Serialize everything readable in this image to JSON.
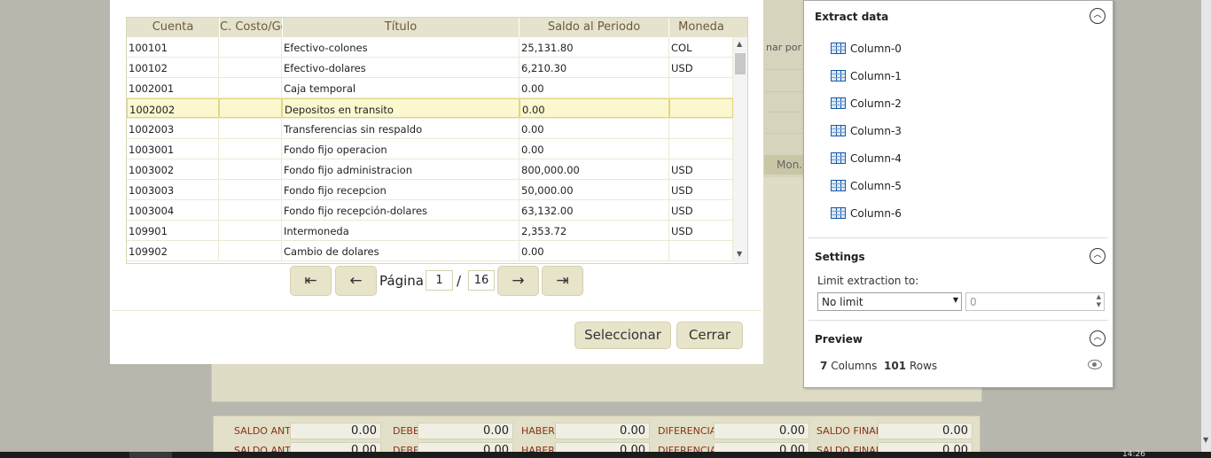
{
  "background": {
    "side_text": "nar por T",
    "mon_label": "Mon.",
    "totals_rows": [
      [
        {
          "label": "SALDO ANT.",
          "value": "0.00"
        },
        {
          "label": "DEBE",
          "value": "0.00"
        },
        {
          "label": "HABER",
          "value": "0.00"
        },
        {
          "label": "DIFERENCIA",
          "value": "0.00"
        },
        {
          "label": "SALDO FINAL",
          "value": "0.00"
        }
      ],
      [
        {
          "label": "SALDO ANT.",
          "value": "0.00"
        },
        {
          "label": "DEBE",
          "value": "0.00"
        },
        {
          "label": "HABER",
          "value": "0.00"
        },
        {
          "label": "DIFERENCIA",
          "value": "0.00"
        },
        {
          "label": "SALDO FINAL",
          "value": "0.00"
        }
      ]
    ],
    "clock": "14:26"
  },
  "dialog": {
    "columns": [
      "Cuenta",
      "C. Costo/Gc",
      "Título",
      "Saldo al Periodo",
      "Moneda"
    ],
    "rows": [
      [
        "100101",
        "",
        "Efectivo-colones",
        "25,131.80",
        "COL"
      ],
      [
        "100102",
        "",
        "Efectivo-dolares",
        "6,210.30",
        "USD"
      ],
      [
        "1002001",
        "",
        "Caja temporal",
        "0.00",
        ""
      ],
      [
        "1002002",
        "",
        "Depositos en transito",
        "0.00",
        ""
      ],
      [
        "1002003",
        "",
        "Transferencias sin respaldo",
        "0.00",
        ""
      ],
      [
        "1003001",
        "",
        "Fondo fijo operacion",
        "0.00",
        ""
      ],
      [
        "1003002",
        "",
        "Fondo fijo administracion",
        "800,000.00",
        "USD"
      ],
      [
        "1003003",
        "",
        "Fondo fijo recepcion",
        "50,000.00",
        "USD"
      ],
      [
        "1003004",
        "",
        "Fondo fijo recepción-dolares",
        "63,132.00",
        "USD"
      ],
      [
        "109901",
        "",
        "Intermoneda",
        "2,353.72",
        "USD"
      ],
      [
        "109902",
        "",
        "Cambio de dolares",
        "0.00",
        ""
      ]
    ],
    "selected_row": 3,
    "pager": {
      "first": "⇤",
      "prev": "←",
      "label": "Página",
      "page": "1",
      "separator": "/",
      "total": "16",
      "next": "→",
      "last": "⇥"
    },
    "select_button": "Seleccionar",
    "close_button": "Cerrar"
  },
  "extract_panel": {
    "extract_title": "Extract data",
    "columns": [
      "Column-0",
      "Column-1",
      "Column-2",
      "Column-3",
      "Column-4",
      "Column-5",
      "Column-6"
    ],
    "settings_title": "Settings",
    "limit_label": "Limit extraction to:",
    "limit_value": "No limit",
    "limit_number_placeholder": "0",
    "preview_title": "Preview",
    "preview_columns_count": "7",
    "preview_columns_label": "Columns",
    "preview_rows_count": "101",
    "preview_rows_label": "Rows",
    "collapse_glyph": "︿"
  },
  "colors": {
    "accent_beige": "#e7e4c9",
    "selected_row": "#fbf7cf",
    "header_text": "#6b5b3b",
    "totals_label": "#8a2f1a"
  }
}
